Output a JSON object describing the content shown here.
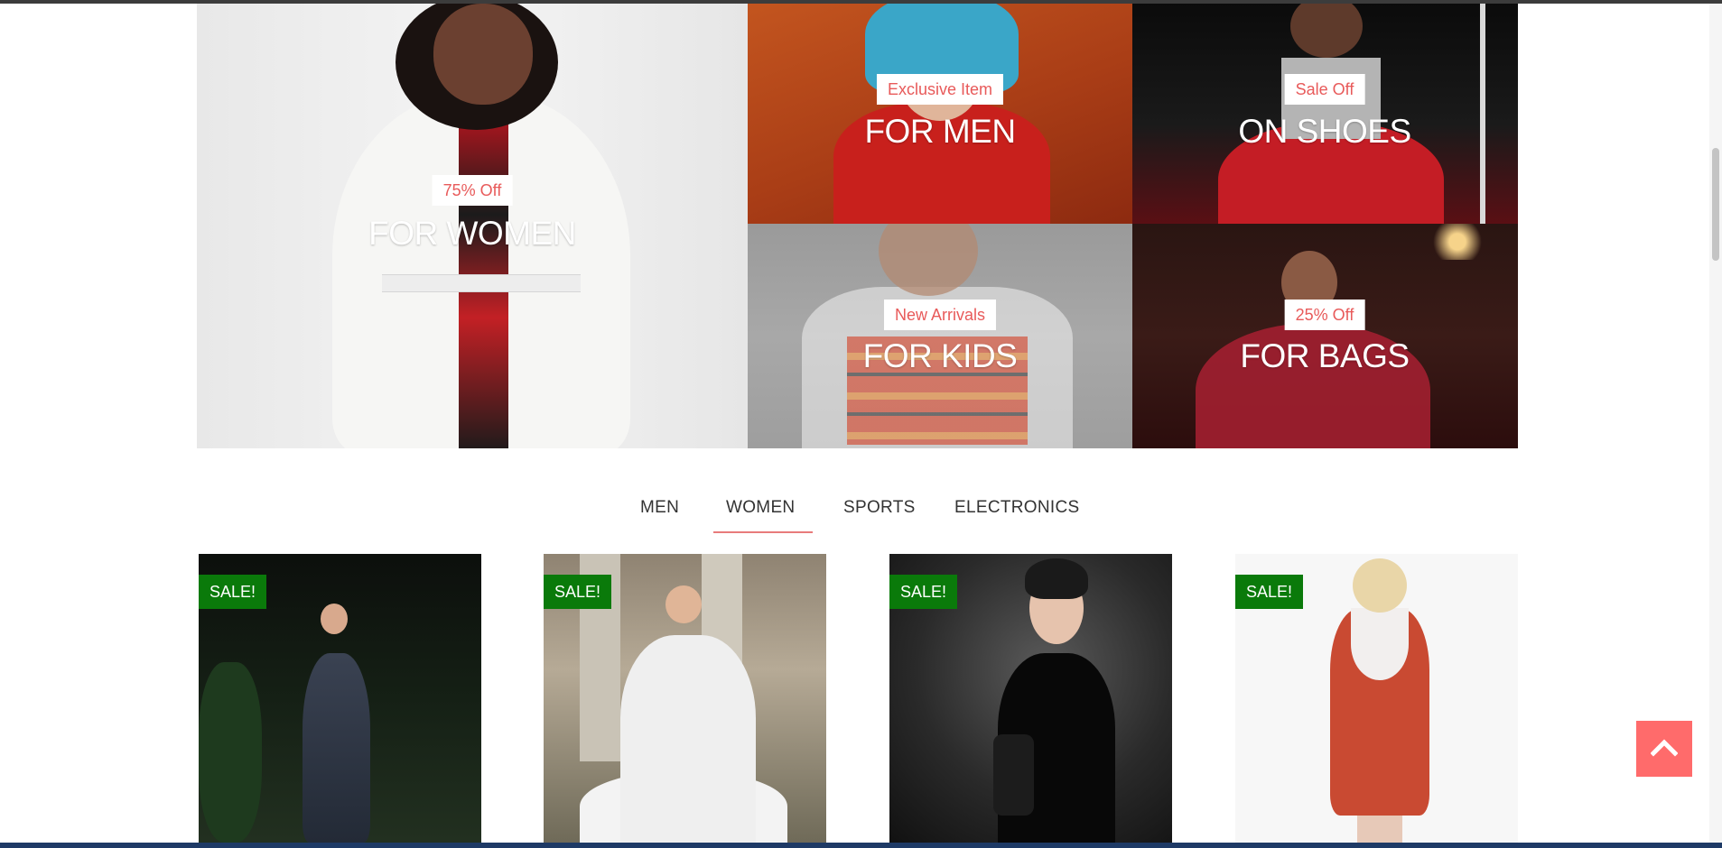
{
  "banners": {
    "women": {
      "tag": "75% Off",
      "title": "FOR WOMEN"
    },
    "men": {
      "tag": "Exclusive Item",
      "title": "FOR MEN"
    },
    "shoes": {
      "tag": "Sale Off",
      "title": "ON SHOES"
    },
    "kids": {
      "tag": "New Arrivals",
      "title": "FOR KIDS"
    },
    "bags": {
      "tag": "25% Off",
      "title": "FOR BAGS"
    }
  },
  "tabs": [
    {
      "label": "MEN"
    },
    {
      "label": "WOMEN",
      "active": true
    },
    {
      "label": "SPORTS"
    },
    {
      "label": "ELECTRONICS"
    }
  ],
  "products": [
    {
      "badge": "SALE!"
    },
    {
      "badge": "SALE!"
    },
    {
      "badge": "SALE!"
    },
    {
      "badge": "SALE!"
    }
  ],
  "colors": {
    "tag_text": "#e85a5a",
    "sale_badge": "#0a7a0a",
    "back_to_top": "#ff6b6b",
    "tab_underline": "#e87b7b"
  },
  "icons": {
    "back_to_top": "chevron-up-icon"
  }
}
